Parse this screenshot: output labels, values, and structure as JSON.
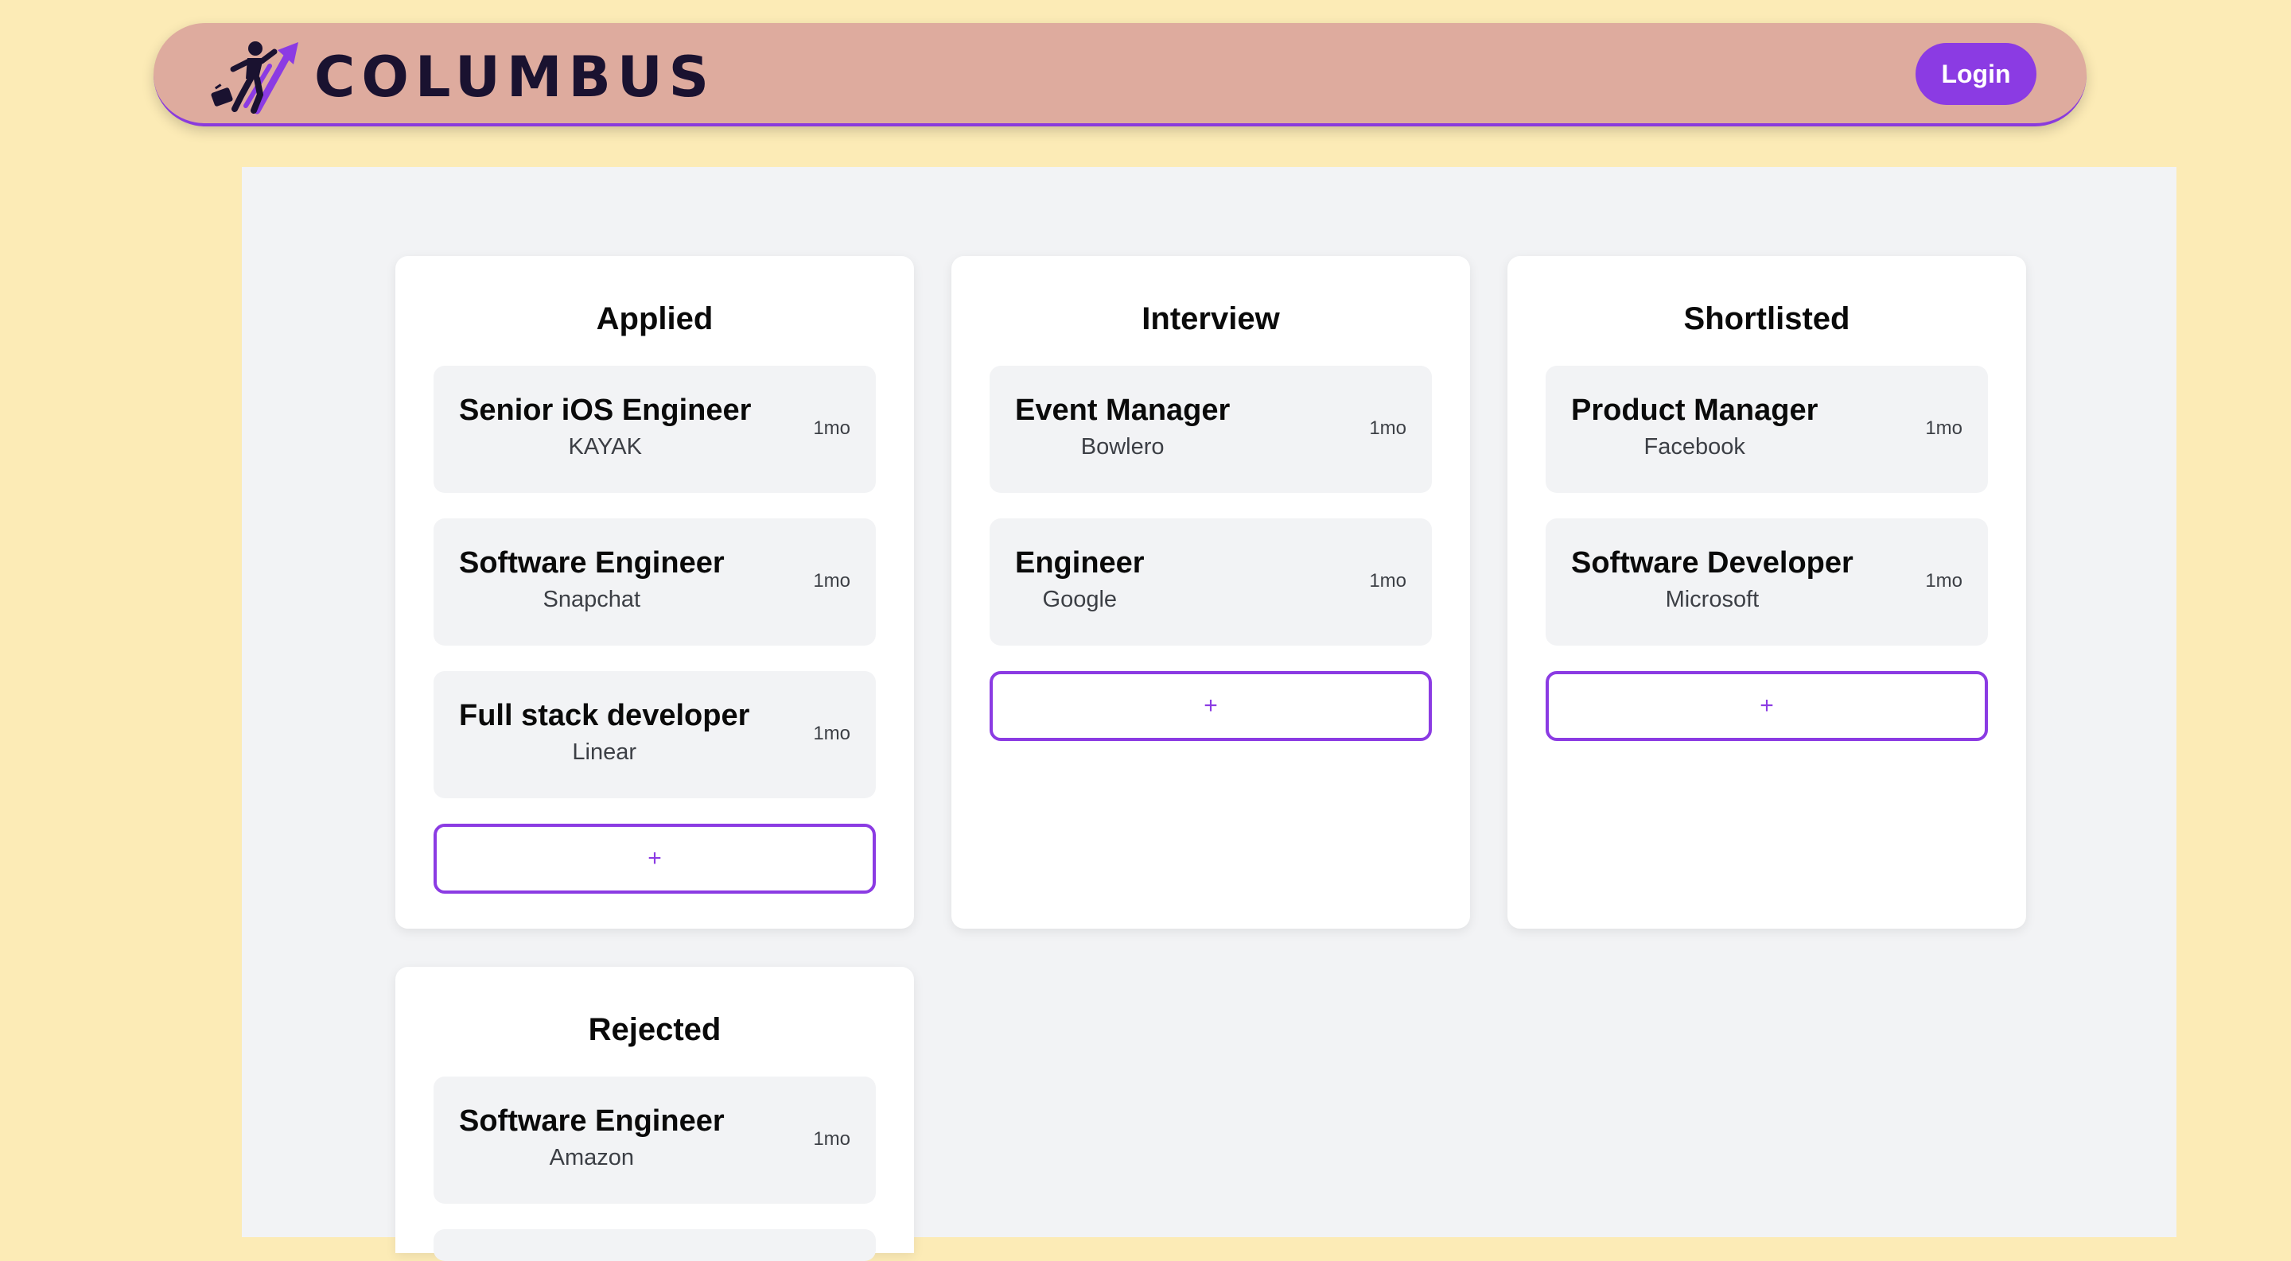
{
  "brand": {
    "name": "COLUMBUS",
    "icon": "rocket-runner-logo-icon"
  },
  "header": {
    "login_label": "Login"
  },
  "colors": {
    "page_background": "#fcebb6",
    "navbar_background": "#deab9e",
    "accent": "#8b3be3",
    "board_background": "#f2f3f5",
    "card_background": "#f2f3f5"
  },
  "columns": [
    {
      "title": "Applied",
      "add_label": "+",
      "cards": [
        {
          "title": "Senior iOS Engineer",
          "company": "KAYAK",
          "age": "1mo"
        },
        {
          "title": "Software Engineer",
          "company": "Snapchat",
          "age": "1mo"
        },
        {
          "title": "Full stack developer",
          "company": "Linear",
          "age": "1mo"
        }
      ]
    },
    {
      "title": "Interview",
      "add_label": "+",
      "cards": [
        {
          "title": "Event Manager",
          "company": "Bowlero",
          "age": "1mo"
        },
        {
          "title": "Engineer",
          "company": "Google",
          "age": "1mo"
        }
      ]
    },
    {
      "title": "Shortlisted",
      "add_label": "+",
      "cards": [
        {
          "title": "Product Manager",
          "company": "Facebook",
          "age": "1mo"
        },
        {
          "title": "Software Developer",
          "company": "Microsoft",
          "age": "1mo"
        }
      ]
    },
    {
      "title": "Rejected",
      "add_label": "+",
      "cards": [
        {
          "title": "Software Engineer",
          "company": "Amazon",
          "age": "1mo"
        }
      ]
    }
  ]
}
